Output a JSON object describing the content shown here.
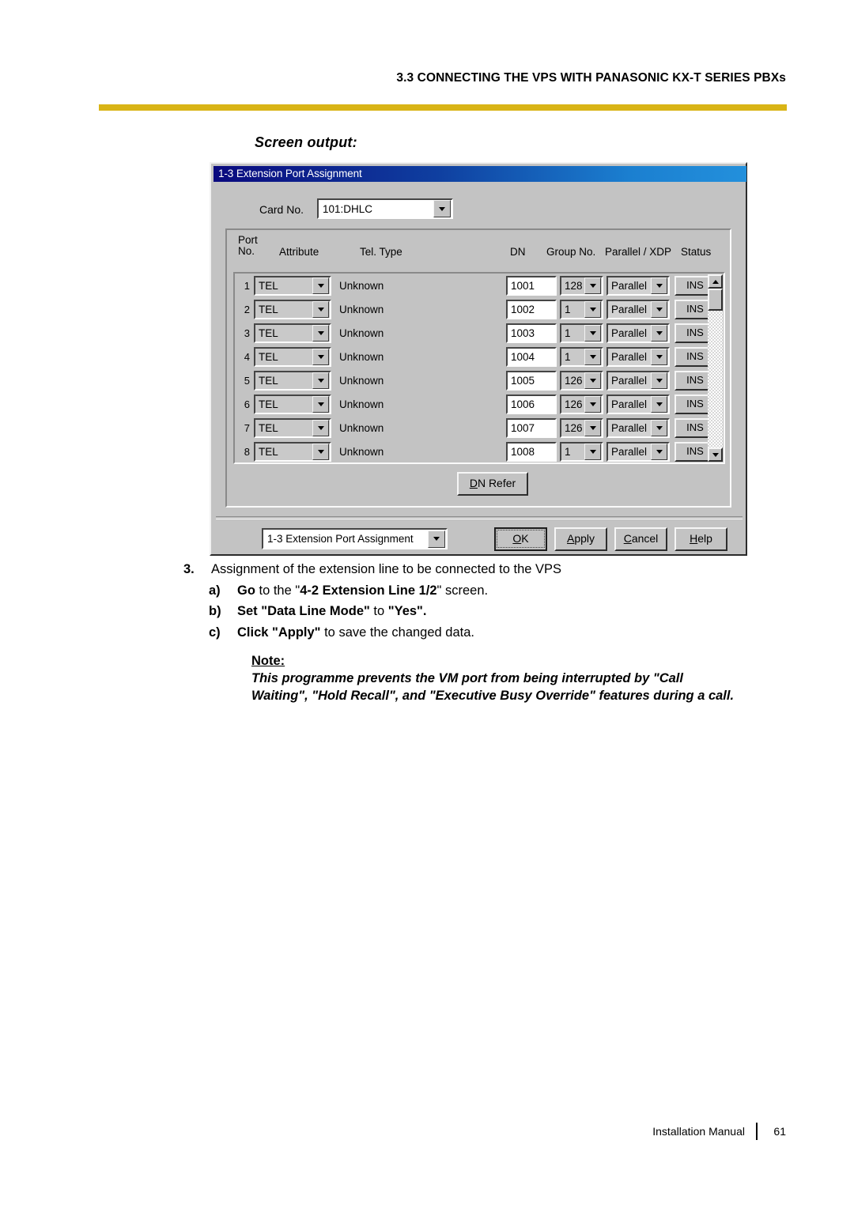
{
  "header": {
    "title": "3.3 CONNECTING THE VPS WITH PANASONIC KX-T SERIES PBXs",
    "rule_color": "#d9b416"
  },
  "screen_output_label": "Screen output:",
  "dialog": {
    "titlebar": "1-3 Extension Port Assignment",
    "card_no": {
      "label": "Card No.",
      "value": "101:DHLC"
    },
    "columns": {
      "port_no_line1": "Port",
      "port_no_line2": "No.",
      "attribute": "Attribute",
      "tel_type": "Tel. Type",
      "dn": "DN",
      "group_no": "Group No.",
      "parallel_xdp": "Parallel / XDP",
      "status": "Status"
    },
    "rows": [
      {
        "no": "1",
        "attribute": "TEL",
        "tel_type": "Unknown",
        "dn": "1001",
        "group_no": "128",
        "parallel": "Parallel",
        "status": "INS"
      },
      {
        "no": "2",
        "attribute": "TEL",
        "tel_type": "Unknown",
        "dn": "1002",
        "group_no": "1",
        "parallel": "Parallel",
        "status": "INS"
      },
      {
        "no": "3",
        "attribute": "TEL",
        "tel_type": "Unknown",
        "dn": "1003",
        "group_no": "1",
        "parallel": "Parallel",
        "status": "INS"
      },
      {
        "no": "4",
        "attribute": "TEL",
        "tel_type": "Unknown",
        "dn": "1004",
        "group_no": "1",
        "parallel": "Parallel",
        "status": "INS"
      },
      {
        "no": "5",
        "attribute": "TEL",
        "tel_type": "Unknown",
        "dn": "1005",
        "group_no": "126",
        "parallel": "Parallel",
        "status": "INS"
      },
      {
        "no": "6",
        "attribute": "TEL",
        "tel_type": "Unknown",
        "dn": "1006",
        "group_no": "126",
        "parallel": "Parallel",
        "status": "INS"
      },
      {
        "no": "7",
        "attribute": "TEL",
        "tel_type": "Unknown",
        "dn": "1007",
        "group_no": "126",
        "parallel": "Parallel",
        "status": "INS"
      },
      {
        "no": "8",
        "attribute": "TEL",
        "tel_type": "Unknown",
        "dn": "1008",
        "group_no": "1",
        "parallel": "Parallel",
        "status": "INS"
      }
    ],
    "dn_refer": {
      "accel": "D",
      "rest": "N Refer"
    },
    "page_select": "1-3 Extension Port Assignment",
    "buttons": {
      "ok": {
        "accel": "O",
        "pre": "",
        "rest": "K"
      },
      "apply": {
        "accel": "A",
        "pre": "",
        "rest": "pply"
      },
      "cancel": {
        "accel": "C",
        "pre": "",
        "rest": "ancel"
      },
      "help": {
        "accel": "H",
        "pre": "",
        "rest": "elp"
      }
    }
  },
  "instructions": {
    "step3": {
      "num": "3.",
      "text": "Assignment of the extension line to be connected to the VPS"
    },
    "a": {
      "letter": "a)",
      "bold1": "Go",
      "mid1": " to the \"",
      "bold2": "4-2 Extension Line 1/2",
      "mid2": "\" screen."
    },
    "b": {
      "letter": "b)",
      "bold1": "Set \"Data Line Mode\"",
      "mid1": " to ",
      "bold2": "\"Yes\".",
      "mid2": ""
    },
    "c": {
      "letter": "c)",
      "bold1": "Click \"Apply\"",
      "mid1": " to save the changed data.",
      "bold2": "",
      "mid2": ""
    }
  },
  "note": {
    "title": "Note:",
    "line1": "This programme prevents the VM port from being interrupted by \"Call",
    "line2": "Waiting\", \"Hold Recall\", and \"Executive Busy Override\" features during a call."
  },
  "footer": {
    "manual": "Installation Manual",
    "page": "61"
  }
}
